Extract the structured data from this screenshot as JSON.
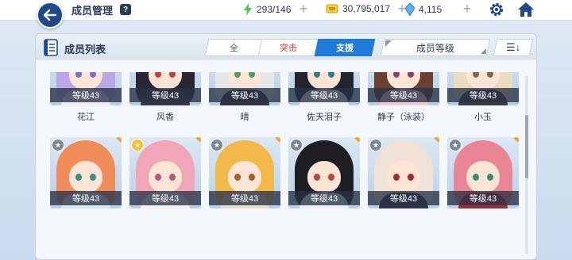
{
  "header": {
    "title": "成员管理",
    "help_glyph": "?",
    "stamina": "293/146",
    "credits": "30,795,017",
    "gems": "4,115",
    "plus": "+"
  },
  "panel": {
    "title": "成员列表",
    "tabs": [
      {
        "label": "全",
        "active": false
      },
      {
        "label": "突击",
        "active": false,
        "color": "#e0303a"
      },
      {
        "label": "支援",
        "active": true
      }
    ],
    "sort_label": "成员等级",
    "order_label": "☰↓"
  },
  "members": [
    {
      "level": "等级43",
      "name": "花江",
      "pin": "gray",
      "hair": "#b9a7e6",
      "eye": "#7b6bd4",
      "body": "#f3e9f5"
    },
    {
      "level": "等级43",
      "name": "风香",
      "pin": "gray",
      "hair": "#2a2530",
      "eye": "#c63b3b",
      "body": "#3a3340"
    },
    {
      "level": "等级43",
      "name": "晴",
      "pin": "gray",
      "hair": "#e8e6e6",
      "eye": "#4f9c6a",
      "body": "#2f3442"
    },
    {
      "level": "等级43",
      "name": "佐天泪子",
      "pin": "gray",
      "hair": "#22252e",
      "eye": "#2f7d82",
      "body": "#f2f2f2"
    },
    {
      "level": "等级43",
      "name": "静子（泳装）",
      "pin": "gray",
      "hair": "#6b4032",
      "eye": "#8e3a6c",
      "body": "#f4c9d0"
    },
    {
      "level": "等级43",
      "name": "小玉",
      "pin": "gray",
      "hair": "#e9dcc0",
      "eye": "#7a6a48",
      "body": "#3b3a3e"
    },
    {
      "level": "等级43",
      "name": "",
      "pin": "gray",
      "hair": "#f08c5a",
      "eye": "#3b8d8a",
      "body": "#dbe7ef"
    },
    {
      "level": "等级43",
      "name": "",
      "pin": "gold",
      "hair": "#f2a7b8",
      "eye": "#b05b7a",
      "body": "#f7f0f3"
    },
    {
      "level": "等级43",
      "name": "",
      "pin": "gray",
      "hair": "#f2b84a",
      "eye": "#a0612a",
      "body": "#e6dcc8"
    },
    {
      "level": "等级43",
      "name": "",
      "pin": "gray",
      "hair": "#1e1d24",
      "eye": "#b8453a",
      "body": "#eef0f3"
    },
    {
      "level": "等级43",
      "name": "",
      "pin": "gray",
      "hair": "#f0e2d6",
      "eye": "#9b2d2d",
      "body": "#2e3344"
    },
    {
      "level": "等级43",
      "name": "",
      "pin": "gray",
      "hair": "#ea8596",
      "eye": "#3c8b74",
      "body": "#a02a38"
    }
  ],
  "colors": {
    "accent": "#1e7bd9",
    "back_button": "#1e4a8c",
    "level_bar": "#283246"
  }
}
